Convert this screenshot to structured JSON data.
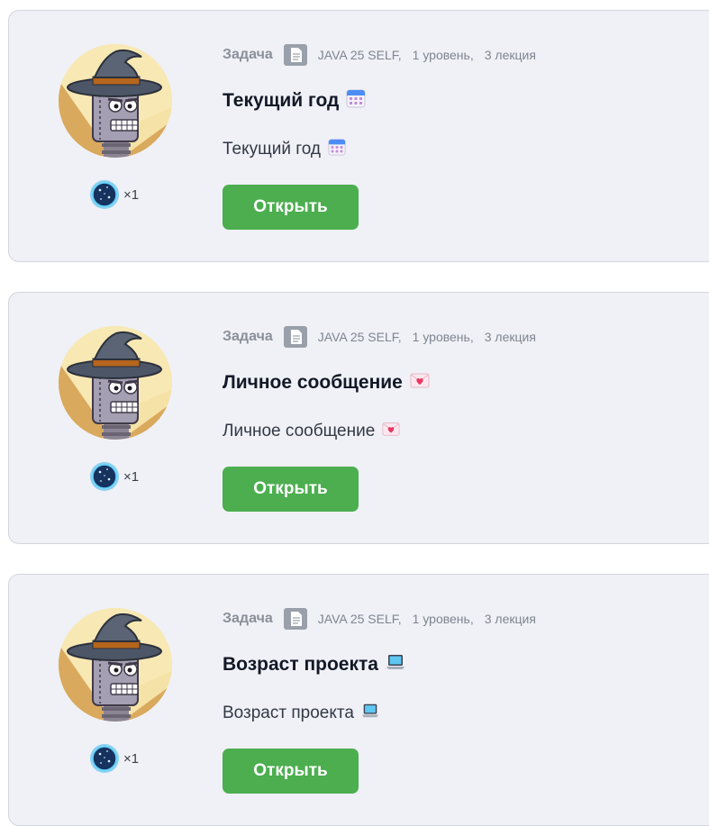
{
  "cards": [
    {
      "type_label": "Задача",
      "course": "JAVA 25 SELF,",
      "level": "1 уровень,",
      "lecture": "3 лекция",
      "title": "Текущий год",
      "description": "Текущий год",
      "emoji": "calendar-icon",
      "reward_count": "×1",
      "button_label": "Открыть"
    },
    {
      "type_label": "Задача",
      "course": "JAVA 25 SELF,",
      "level": "1 уровень,",
      "lecture": "3 лекция",
      "title": "Личное сообщение",
      "description": "Личное сообщение",
      "emoji": "love-letter-icon",
      "reward_count": "×1",
      "button_label": "Открыть"
    },
    {
      "type_label": "Задача",
      "course": "JAVA 25 SELF,",
      "level": "1 уровень,",
      "lecture": "3 лекция",
      "title": "Возраст проекта",
      "description": "Возраст проекта",
      "emoji": "laptop-icon",
      "reward_count": "×1",
      "button_label": "Открыть"
    }
  ],
  "colors": {
    "card_bg": "#eff1f6",
    "button_green": "#4cae4f",
    "title_text": "#121826",
    "meta_text": "#7f8490"
  }
}
